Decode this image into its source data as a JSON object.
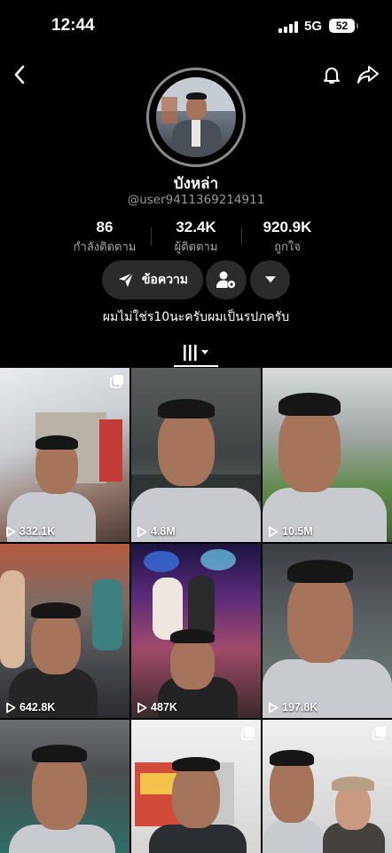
{
  "status_bar": {
    "time": "12:44",
    "network": "5G",
    "battery": "52"
  },
  "header": {
    "back_icon": "chevron-left-icon",
    "bell_icon": "bell-icon",
    "share_icon": "share-arrow-icon"
  },
  "profile": {
    "display_name": "บังหล่า",
    "username": "@user9411369214911",
    "bio": "ผมไม่ใช่ร10นะครับผมเป็นรปภครับ"
  },
  "stats": [
    {
      "value": "86",
      "label": "กำลังติดตาม"
    },
    {
      "value": "32.4K",
      "label": "ผู้ติดตาม"
    },
    {
      "value": "920.9K",
      "label": "ถูกใจ"
    }
  ],
  "actions": {
    "message_label": "ข้อความ"
  },
  "videos": [
    {
      "views": "332.1K",
      "multi": true
    },
    {
      "views": "4.8M",
      "multi": false
    },
    {
      "views": "10.5M",
      "multi": false
    },
    {
      "views": "642.8K",
      "multi": false
    },
    {
      "views": "487K",
      "multi": false
    },
    {
      "views": "197.8K",
      "multi": false
    },
    {
      "views": "",
      "multi": false
    },
    {
      "views": "",
      "multi": true
    },
    {
      "views": "",
      "multi": true
    }
  ]
}
